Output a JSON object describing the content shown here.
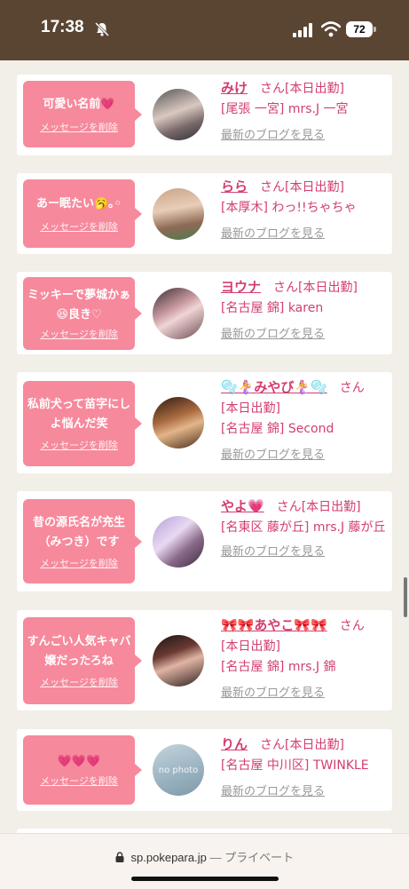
{
  "status_bar": {
    "time": "17:38",
    "battery": "72"
  },
  "delete_label": "メッセージを削除",
  "san": "さん",
  "blog_label": "最新のブログを見る",
  "cards": [
    {
      "message": "可愛い名前💗",
      "name": "みけ",
      "line1": "[本日出勤]",
      "line2": "[尾張 一宮] mrs.J 一宮"
    },
    {
      "message": "あー眠たい🥱｡◦",
      "name": "らら",
      "line1": "[本日出勤]",
      "line2": "[本厚木] わっ!!ちゃちゃ"
    },
    {
      "message": "ミッキーで夢城かぁ😆良き♡",
      "name": "ヨウナ",
      "line1": "[本日出勤]",
      "line2": "[名古屋 錦] karen"
    },
    {
      "message": "私前犬って苗字にしよ悩んだ笑",
      "name": "🫧🧜‍♀️みやび🧜‍♀️🫧",
      "line1": "[本日出勤]",
      "line2": "[名古屋 錦] Second"
    },
    {
      "message": "昔の源氏名が充生（みつき）です",
      "name": "やよ💗",
      "line1": "[本日出勤]",
      "line2": "[名東区 藤が丘] mrs.J 藤が丘"
    },
    {
      "message": "すんごい人気キャバ嬢だったろね",
      "name": "🎀🎀あやこ🎀🎀",
      "line1": "[本日出勤]",
      "line2": "[名古屋 錦] mrs.J 錦"
    },
    {
      "message": "💗💗💗",
      "name": "りん",
      "line1": "[本日出勤]",
      "line2": "[名古屋 中川区] TWINKLE",
      "avatar_text": "no photo"
    }
  ],
  "browser": {
    "domain": "sp.pokepara.jp",
    "separator": "—",
    "mode": "プライベート"
  }
}
